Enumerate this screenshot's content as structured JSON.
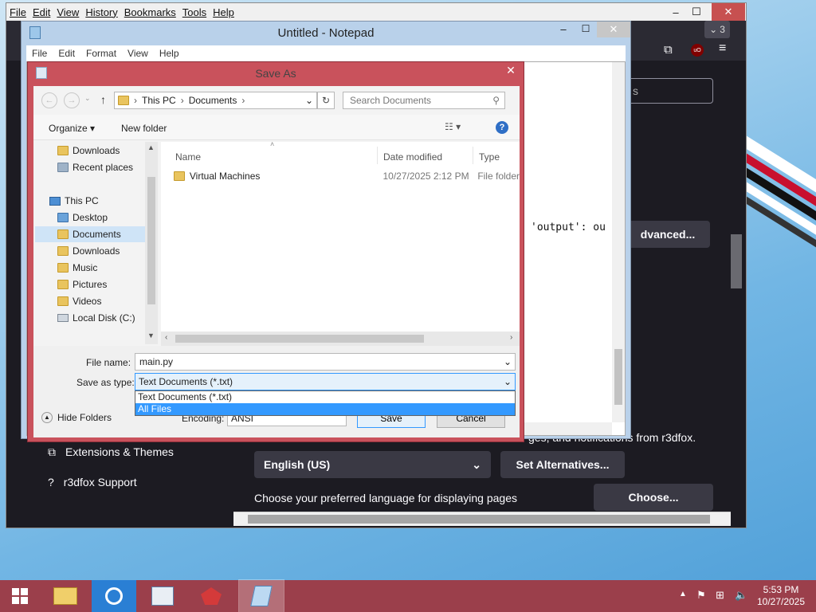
{
  "firefox": {
    "menu": [
      "File",
      "Edit",
      "View",
      "History",
      "Bookmarks",
      "Tools",
      "Help"
    ],
    "window_controls": {
      "minimize": "–",
      "maximize": "☐",
      "close": "✕"
    },
    "tab_count": "3",
    "search_placeholder_partial": "s",
    "advanced_button": "dvanced...",
    "notifications_partial": "ges, and notifications from r3dfox.",
    "language_select": "English (US)",
    "set_alternatives_button": "Set Alternatives...",
    "preferred_language_text": "Choose your preferred language for displaying pages",
    "choose_button": "Choose...",
    "sidebar": {
      "extensions": "Extensions & Themes",
      "support": "r3dfox Support"
    },
    "toolbar_icons": [
      "extensions-icon",
      "ublock-icon",
      "menu-icon"
    ]
  },
  "notepad": {
    "title": "Untitled - Notepad",
    "menu": [
      "File",
      "Edit",
      "Format",
      "View",
      "Help"
    ],
    "content_visible": "'output': ou"
  },
  "save_dialog": {
    "title": "Save As",
    "breadcrumb": [
      "This PC",
      "Documents"
    ],
    "search_placeholder": "Search Documents",
    "organize": "Organize",
    "new_folder": "New folder",
    "nav_items": [
      {
        "label": "Downloads",
        "icon": "downloads-folder-icon",
        "selected": false
      },
      {
        "label": "Recent places",
        "icon": "recent-places-icon",
        "selected": false
      },
      {
        "label": "This PC",
        "icon": "computer-icon",
        "selected": false,
        "header": true
      },
      {
        "label": "Desktop",
        "icon": "desktop-folder-icon",
        "selected": false
      },
      {
        "label": "Documents",
        "icon": "documents-folder-icon",
        "selected": true
      },
      {
        "label": "Downloads",
        "icon": "downloads-folder-icon",
        "selected": false
      },
      {
        "label": "Music",
        "icon": "music-folder-icon",
        "selected": false
      },
      {
        "label": "Pictures",
        "icon": "pictures-folder-icon",
        "selected": false
      },
      {
        "label": "Videos",
        "icon": "videos-folder-icon",
        "selected": false
      },
      {
        "label": "Local Disk (C:)",
        "icon": "local-disk-icon",
        "selected": false
      }
    ],
    "columns": {
      "name": "Name",
      "date": "Date modified",
      "type": "Type"
    },
    "files": [
      {
        "name": "Virtual Machines",
        "date": "10/27/2025 2:12 PM",
        "type": "File folder"
      }
    ],
    "file_name_label": "File name:",
    "file_name_value": "main.py",
    "save_type_label": "Save as type:",
    "save_type_value": "Text Documents (*.txt)",
    "save_type_options": [
      "Text Documents (*.txt)",
      "All Files"
    ],
    "hide_folders": "Hide Folders",
    "encoding_label": "Encoding:",
    "encoding_value": "ANSI",
    "save_button": "Save",
    "cancel_button": "Cancel"
  },
  "taskbar": {
    "time": "5:53 PM",
    "date": "10/27/2025",
    "apps": [
      "file-explorer-icon",
      "search-app-icon",
      "control-panel-icon",
      "r3dfox-icon",
      "notepad-icon"
    ]
  },
  "colors": {
    "accent": "#3399ff",
    "dialog_frame": "#c9525c",
    "taskbar": "#9b3f4b"
  }
}
